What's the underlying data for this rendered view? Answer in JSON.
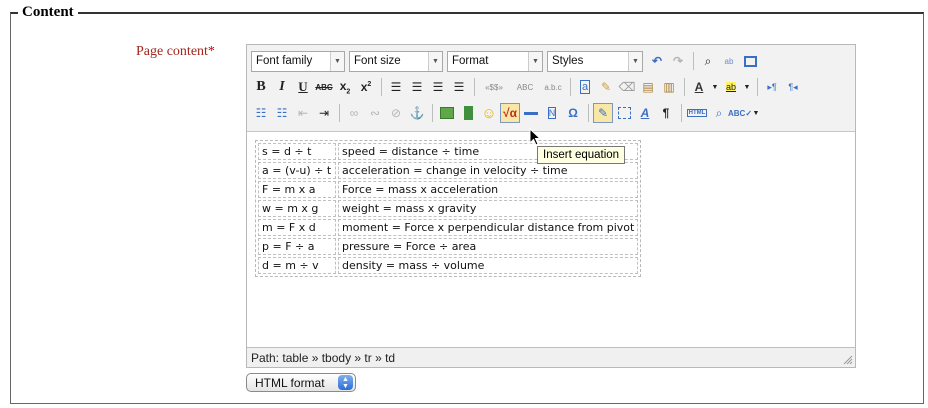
{
  "fieldset": {
    "legend": "Content"
  },
  "field": {
    "label": "Page content",
    "required_mark": "*"
  },
  "toolbar": {
    "font_family": "Font family",
    "font_size": "Font size",
    "format": "Format",
    "styles": "Styles",
    "html_label": "HTML"
  },
  "tooltip": "Insert equation",
  "table_rows": [
    {
      "eq": "s = d ÷ t",
      "desc": "speed = distance ÷ time"
    },
    {
      "eq": "a = (v-u) ÷ t",
      "desc": "acceleration = change in velocity ÷ time"
    },
    {
      "eq": "F = m x a",
      "desc": "Force = mass x acceleration"
    },
    {
      "eq": "w = m x g",
      "desc": "weight = mass x gravity"
    },
    {
      "eq": "m = F x d",
      "desc": "moment = Force x perpendicular distance from pivot"
    },
    {
      "eq": "p = F ÷ a",
      "desc": "pressure = Force ÷ area"
    },
    {
      "eq": "d = m ÷ v",
      "desc": "density = mass ÷ volume"
    }
  ],
  "path": "Path: table » tbody » tr » td",
  "format_select": {
    "value": "HTML format"
  },
  "colors": {
    "label": "#a3251e",
    "required": "#cc0000",
    "tooltip_bg": "#ffffe1",
    "active_button": "#f8e7a6"
  }
}
